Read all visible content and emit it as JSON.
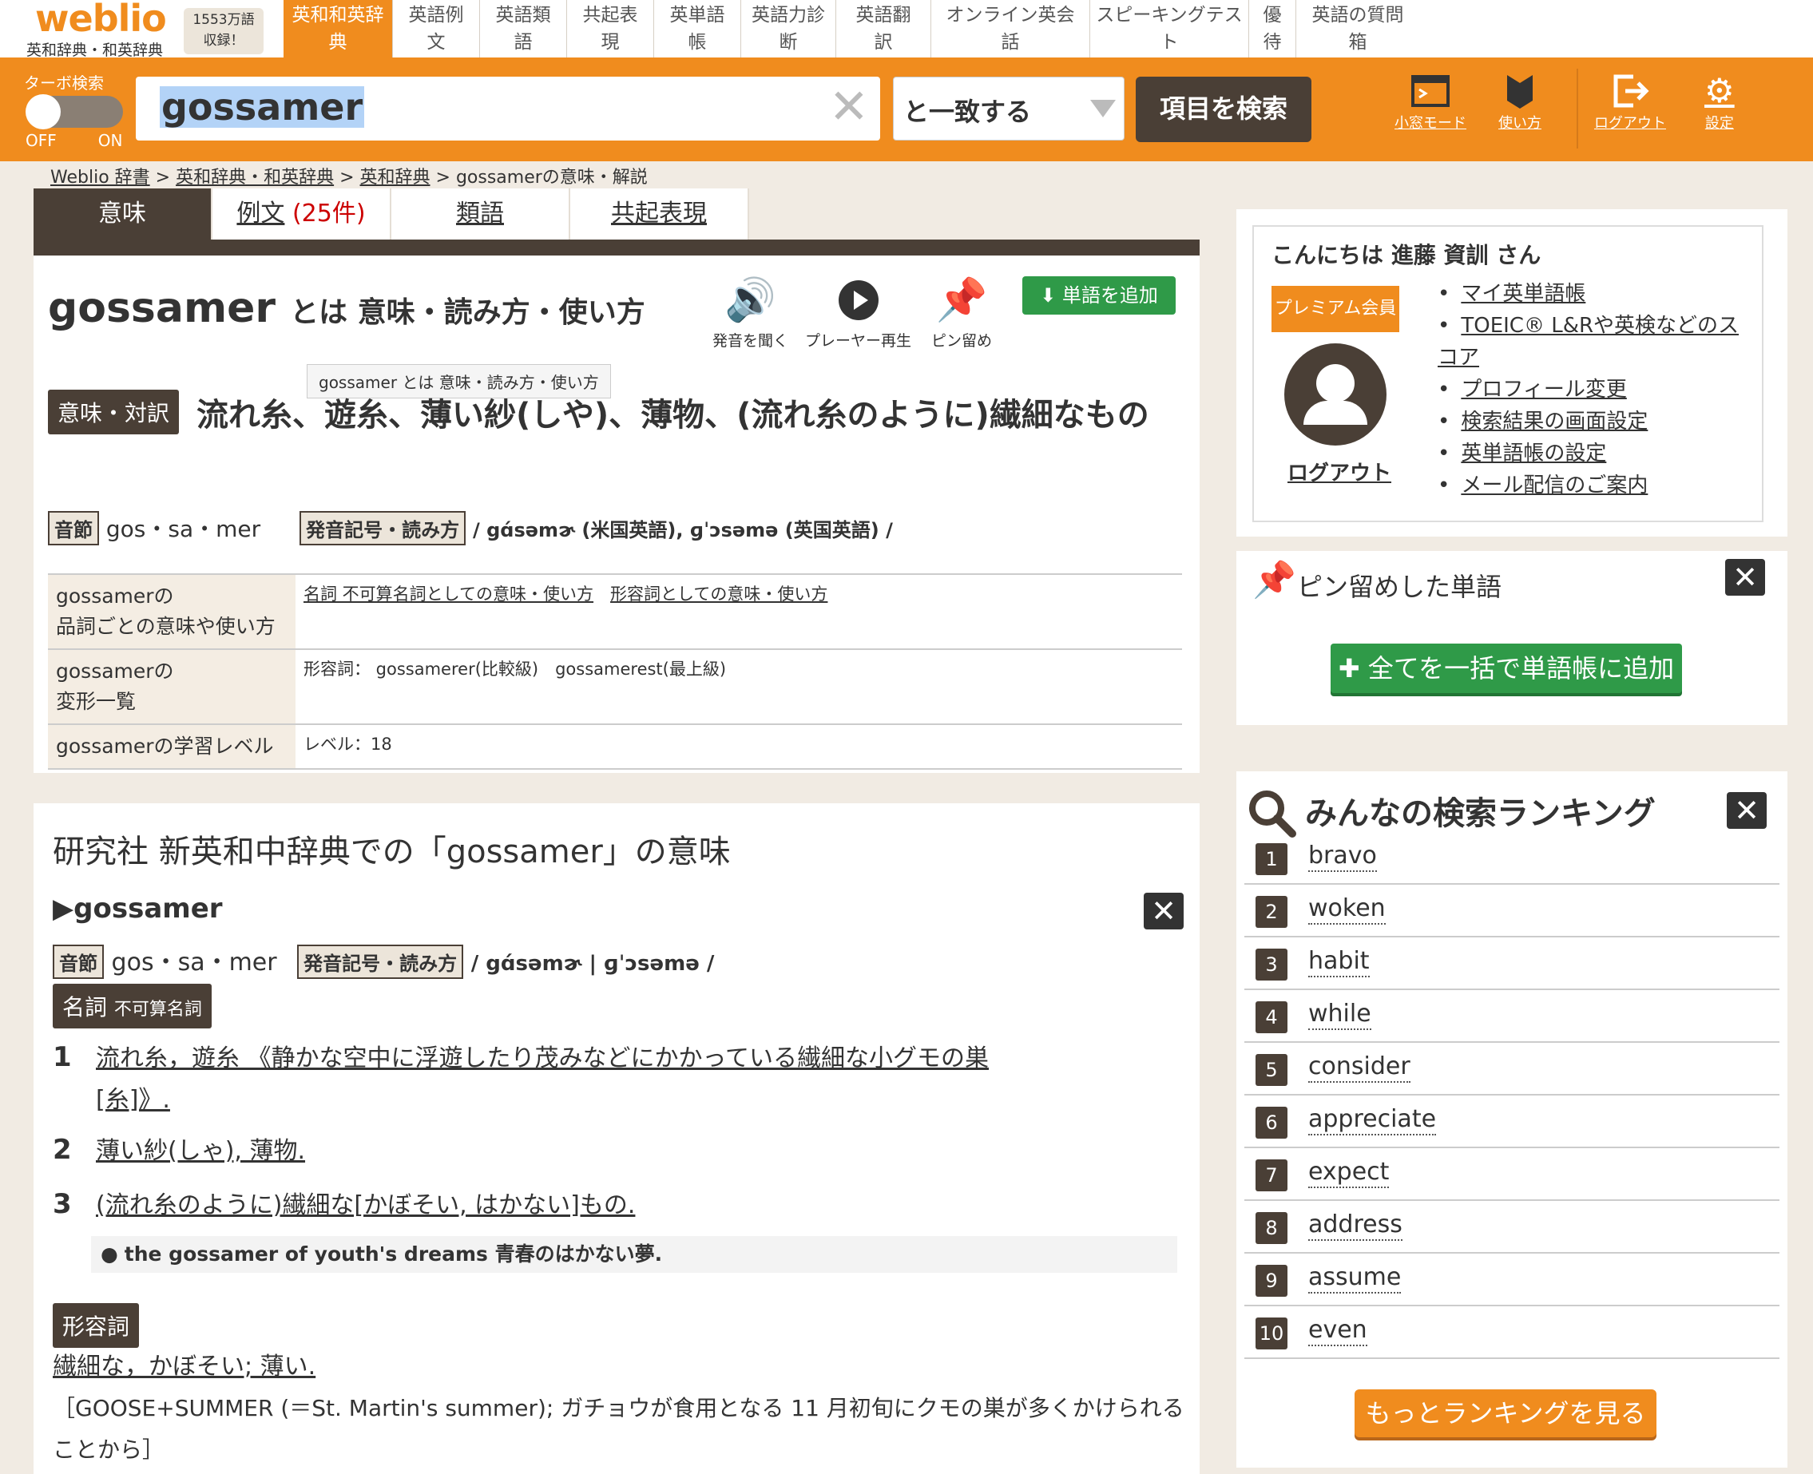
{
  "logo": {
    "name": "weblio",
    "subtitle": "英和辞典・和英辞典",
    "badge_line1": "1553万語",
    "badge_line2": "収録！"
  },
  "nav_tabs": [
    {
      "l1": "英和和英辞",
      "l2": "典"
    },
    {
      "l1": "英語例",
      "l2": "文"
    },
    {
      "l1": "英語類",
      "l2": "語"
    },
    {
      "l1": "共起表",
      "l2": "現"
    },
    {
      "l1": "英単語",
      "l2": "帳"
    },
    {
      "l1": "英語力診",
      "l2": "断"
    },
    {
      "l1": "英語翻",
      "l2": "訳"
    },
    {
      "l1": "オンライン英会",
      "l2": "話"
    },
    {
      "l1": "スピーキングテス",
      "l2": "ト"
    },
    {
      "l1": "優",
      "l2": "待"
    },
    {
      "l1": "英語の質問",
      "l2": "箱"
    }
  ],
  "search": {
    "turbo_label": "ターボ検索",
    "off": "OFF",
    "on": "ON",
    "query": "gossamer",
    "clear_glyph": "✕",
    "match": "と一致する",
    "button": "項目を検索"
  },
  "tools": {
    "mini": "小窓モード",
    "howto": "使い方",
    "logout": "ログアウト",
    "settings": "設定"
  },
  "breadcrumb": {
    "a": "Weblio 辞書",
    "b": "英和辞典・和英辞典",
    "c": "英和辞典",
    "d": "gossamerの意味・解説",
    "sep": " > "
  },
  "content_tabs": {
    "meaning": "意味",
    "examples": "例文",
    "examples_count": "(25件)",
    "synonyms": "類語",
    "collocations": "共起表現"
  },
  "entry": {
    "word": "gossamer",
    "title_rest": "とは 意味・読み方・使い方",
    "btn_sound": "発音を聞く",
    "btn_player": "プレーヤー再生",
    "btn_pin": "ピン留め",
    "btn_add": "単語を追加",
    "tooltip": "gossamer とは 意味・読み方・使い方",
    "meaning_tag": "意味・対訳",
    "meaning_text": "流れ糸、遊糸、薄い紗(しや)、薄物、(流れ糸のように)繊細なもの",
    "syll_tag": "音節",
    "syllables": "gos・sa・mer",
    "pron_tag": "発音記号・読み方",
    "pron": "/ gɑ́səmɚ (米国英語), ɡˈɔsəmə (英国英語) /",
    "info_rows": [
      {
        "h1": "gossamerの",
        "h2": "品詞ごとの意味や使い方",
        "v": "名詞 不可算名詞としての意味・使い方",
        "v2": "形容詞としての意味・使い方"
      },
      {
        "h1": "gossamerの",
        "h2": "変形一覧",
        "v": "形容詞： gossamerer(比較級)　gossamerest(最上級)",
        "v2": ""
      },
      {
        "h1": "gossamerの学習レベル",
        "h2": "",
        "v": "レベル：18",
        "v2": ""
      }
    ]
  },
  "dict2": {
    "title": "研究社 新英和中辞典での「gossamer」の意味",
    "headword": "▶gossamer",
    "syll_tag": "音節",
    "syllables": "gos・sa・mer",
    "pron_tag": "発音記号・読み方",
    "pron": "/ gɑ́səmɚ | ɡˈɔsəmə /",
    "noun_tag": "名詞",
    "noun_sub": "不可算名詞",
    "senses": [
      {
        "n": "1",
        "t": "流れ糸，遊糸 《静かな空中に浮遊したり茂みなどにかかっている繊細な小グモの巣",
        "t2": "[糸]》."
      },
      {
        "n": "2",
        "t": "薄い紗(しゃ), 薄物.",
        "t2": ""
      },
      {
        "n": "3",
        "t": "(流れ糸のように)繊細な[かぼそい, はかない]もの.",
        "t2": ""
      }
    ],
    "example": "the gossamer of youth's dreams 青春のはかない夢.",
    "adj_tag": "形容詞",
    "adj_text": "繊細な，かぼそい; 薄い.",
    "etym": "［GOOSE+SUMMER (＝St. Martin's summer); ガチョウが食用となる 11 月初旬にクモの巣が多くかけられる",
    "etym2": "ことから］"
  },
  "sidebar": {
    "greeting": "こんにちは 進藤 資訓 さん",
    "premium": "プレミアム会員",
    "logout": "ログアウト",
    "menu": [
      "マイ英単語帳",
      "TOEIC® L&Rや英検などのスコア",
      "プロフィール変更",
      "検索結果の画面設定",
      "英単語帳の設定",
      "メール配信のご案内"
    ],
    "pinned_title": "ピン留めした単語",
    "bulk_add": "✚ 全てを一括で単語帳に追加",
    "ranking_title": "みんなの検索ランキング",
    "ranking": [
      "bravo",
      "woken",
      "habit",
      "while",
      "consider",
      "appreciate",
      "expect",
      "address",
      "assume",
      "even"
    ],
    "more": "もっとランキングを見る"
  },
  "colors": {
    "brand_orange": "#f08c1e",
    "dark_brown": "#4a3f36",
    "green": "#2f9a48"
  }
}
